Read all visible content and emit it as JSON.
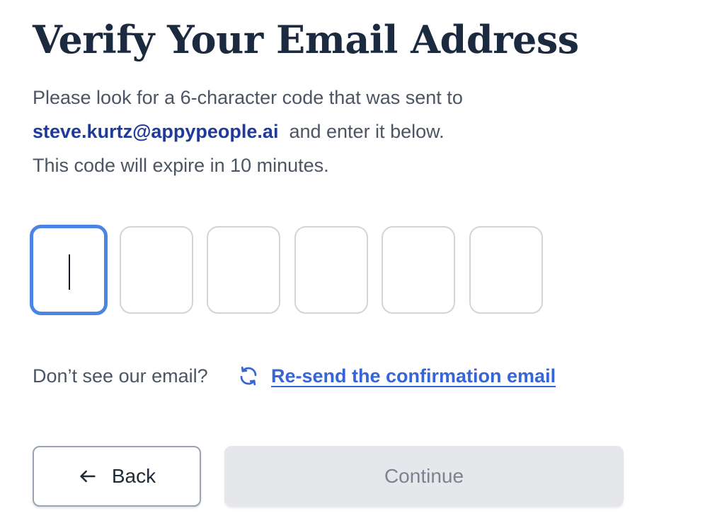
{
  "heading": {
    "title": "Verify Your Email Address"
  },
  "instructions": {
    "line1": "Please look for a 6-character code that was sent to",
    "email": "steve.kurtz@appypeople.ai",
    "line2_suffix": "and enter it below.",
    "line3": "This code will expire in 10 minutes."
  },
  "code_input": {
    "length": 6,
    "digits": [
      "",
      "",
      "",
      "",
      "",
      ""
    ],
    "focused_index": 0
  },
  "resend": {
    "prompt": "Don’t see our email?",
    "icon": "refresh-icon",
    "link_label": "Re-send the confirmation email"
  },
  "actions": {
    "back_label": "Back",
    "back_icon": "arrow-left-icon",
    "continue_label": "Continue",
    "continue_disabled": true
  },
  "colors": {
    "accent": "#4c84e6",
    "link": "#3565d6",
    "email": "#1e3a9a",
    "disabled_bg": "#e6e7ea"
  }
}
